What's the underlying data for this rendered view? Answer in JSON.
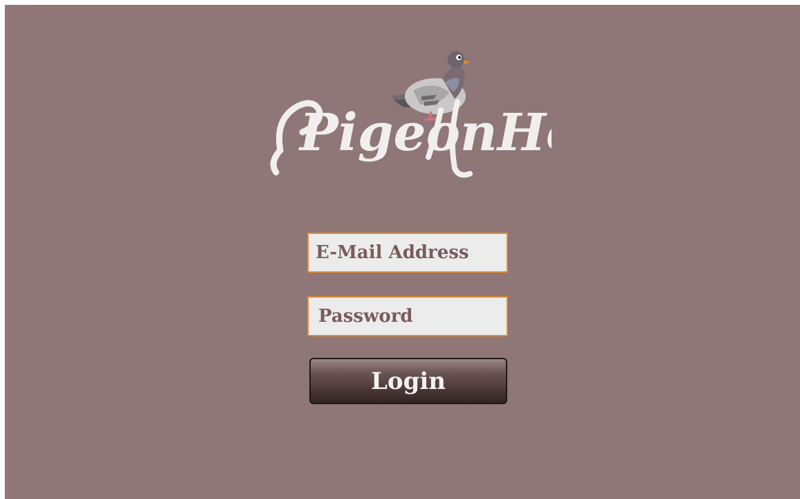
{
  "app": {
    "logo_text": "PigeonHole"
  },
  "form": {
    "email_placeholder": "E-Mail Address",
    "email_value": "",
    "password_placeholder": "Password",
    "password_value": "",
    "login_label": "Login"
  },
  "colors": {
    "background": "#8e7776",
    "input_border": "#e48a2c",
    "input_bg": "#ececec",
    "input_text": "#7a5c5b",
    "button_text": "#f4f1f1"
  },
  "icons": {
    "mascot": "pigeon-icon"
  }
}
